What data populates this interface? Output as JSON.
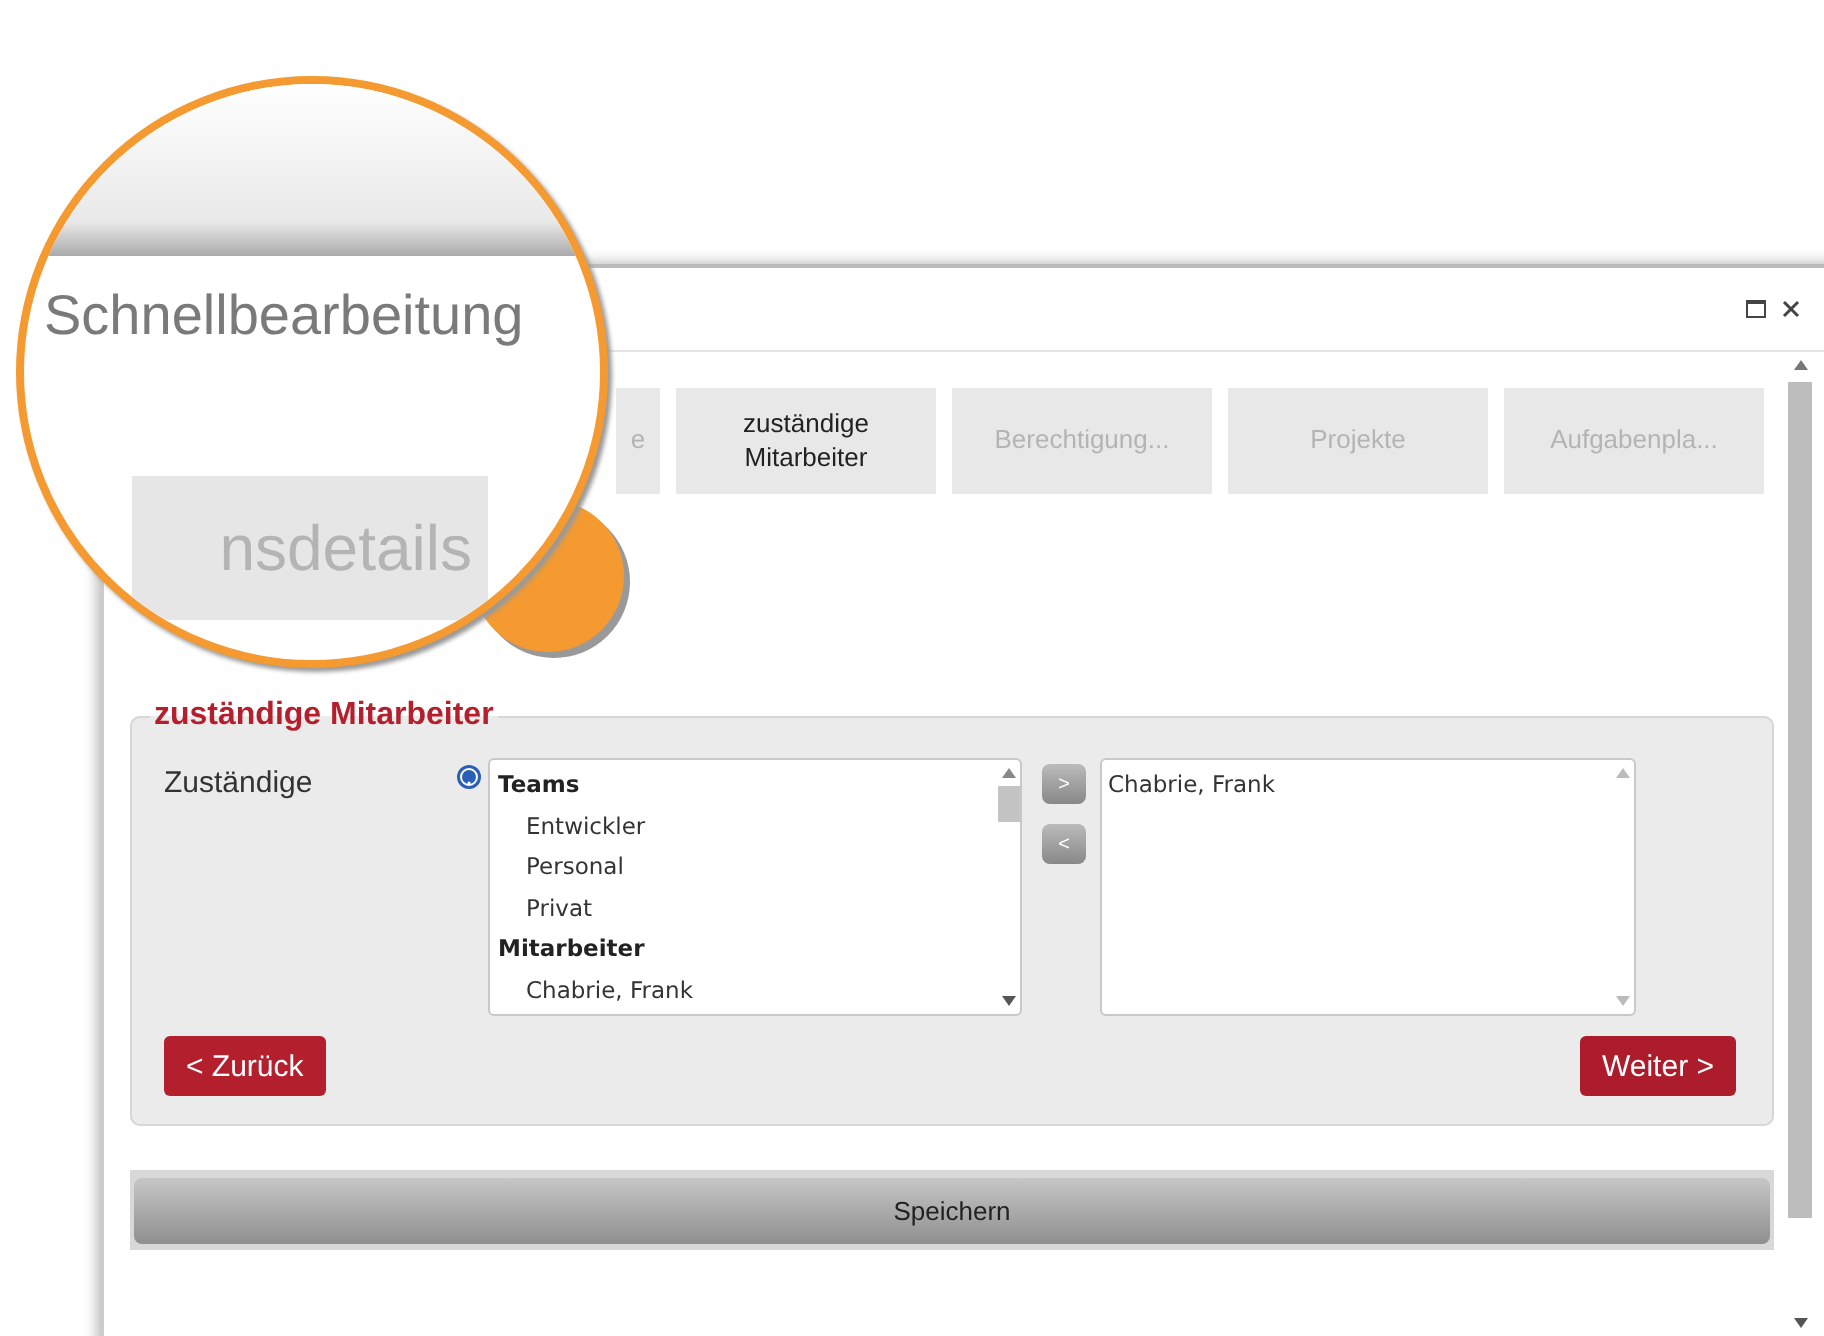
{
  "magnifier": {
    "title": "Schnellbearbeitung",
    "tab": "nsdetails"
  },
  "tabs": [
    {
      "label": "e",
      "selected": false
    },
    {
      "label": "zuständige Mitarbeiter",
      "selected": true
    },
    {
      "label": "Berechtigung...",
      "selected": false
    },
    {
      "label": "Projekte",
      "selected": false
    },
    {
      "label": "Aufgabenpla...",
      "selected": false
    }
  ],
  "section": {
    "legend": "zuständige Mitarbeiter",
    "field_label": "Zuständige",
    "available": [
      {
        "header": "Teams",
        "items": [
          "Entwickler",
          "Personal",
          "Privat"
        ]
      },
      {
        "header": "Mitarbeiter",
        "items": [
          "Chabrie, Frank"
        ]
      }
    ],
    "move_buttons": [
      ">",
      "<"
    ],
    "assigned": [
      "Chabrie, Frank"
    ]
  },
  "nav_buttons": [
    {
      "label": "< Zurück",
      "kind": "back"
    },
    {
      "label": "Weiter >",
      "kind": "next"
    }
  ],
  "save_button": "Speichern"
}
